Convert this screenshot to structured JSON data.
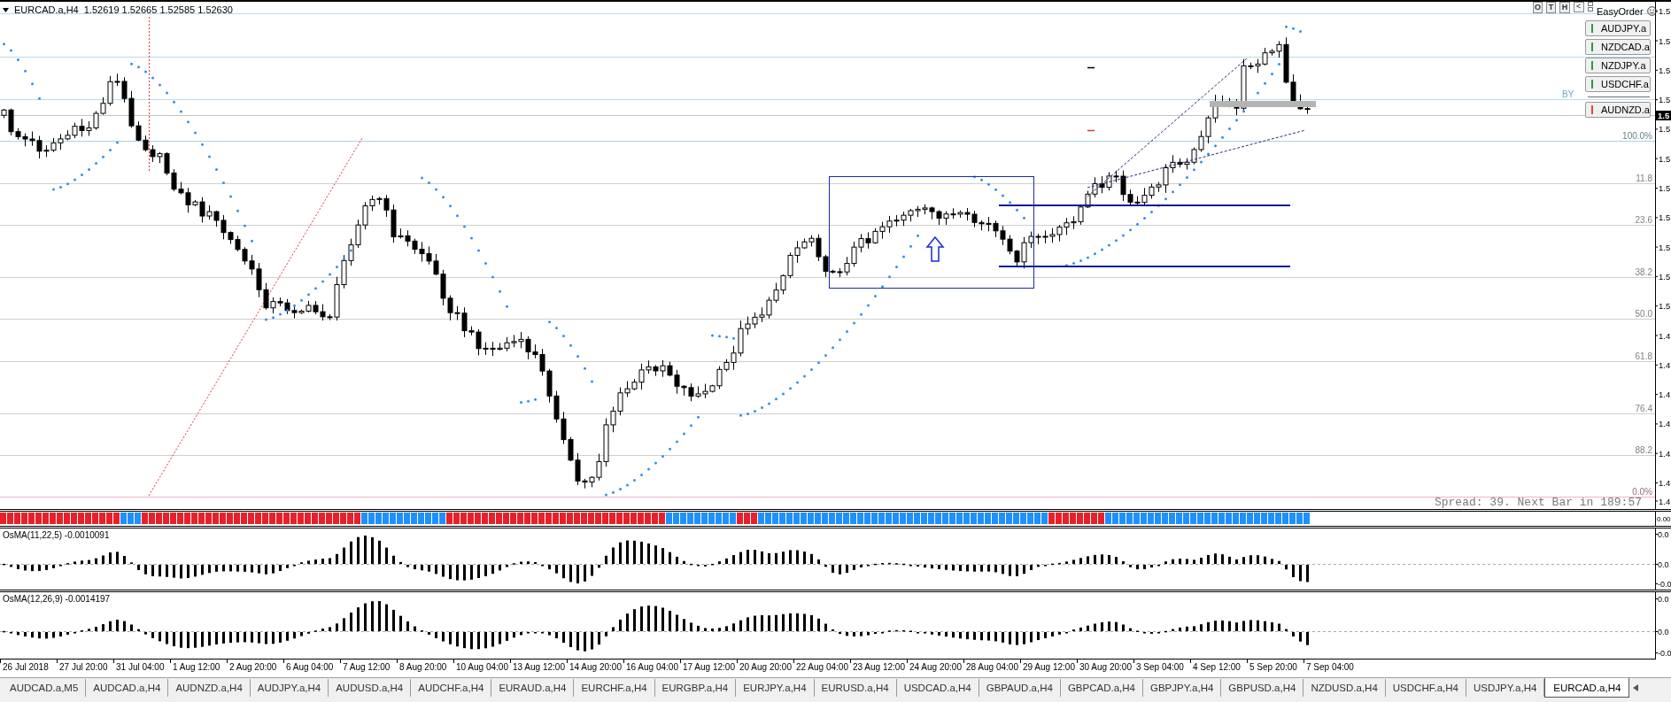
{
  "chart": {
    "symbol": "EURCAD.a,H4",
    "quote": "1.52619 1.52665 1.52585 1.52630",
    "fib_levels": [
      {
        "label": "100.0%",
        "color": "#a9d3e2"
      },
      {
        "label": "11.8",
        "color": "#cfcfcf"
      },
      {
        "label": "23.6",
        "color": "#cfcfcf"
      },
      {
        "label": "38.2",
        "color": "#cfcfcf"
      },
      {
        "label": "50.0",
        "color": "#cfcfcf"
      },
      {
        "label": "61.8",
        "color": "#cfcfcf"
      },
      {
        "label": "76.4",
        "color": "#cfcfcf"
      },
      {
        "label": "88.2",
        "color": "#cfcfcf"
      },
      {
        "label": "0.0%",
        "color": "#f2b3bf"
      }
    ],
    "level_label": "BY",
    "price_axis": [
      "1.5",
      "1.5",
      "1.5",
      "1.5",
      "1.5",
      "1.5",
      "1.5",
      "1.5",
      "1.5",
      "1.5",
      "1.5",
      "1.4",
      "1.4",
      "1.4",
      "1.4",
      "1.4",
      "1.4",
      "1.4"
    ],
    "current_price": "1.5",
    "spread": "Spread: 39. Next Bar in 189:57"
  },
  "easy_order": {
    "buttons": [
      "O",
      "T",
      "H",
      "<"
    ],
    "title": "EasyOrder",
    "symbols": [
      {
        "label": "AUDJPY.a",
        "color": "#2f9a3c"
      },
      {
        "label": "NZDCAD.a",
        "color": "#2f9a3c"
      },
      {
        "label": "NZDJPY.a",
        "color": "#2f9a3c"
      },
      {
        "label": "USDCHF.a",
        "color": "#2f9a3c"
      },
      {
        "label": "AUDNZD.a",
        "color": "#e2453f"
      }
    ]
  },
  "signal_pane": {
    "axis": [
      "0.00"
    ]
  },
  "osma_panes": [
    {
      "label": "OsMA(11,22,5) -0.0010091",
      "axis": [
        "0.0",
        "0.0",
        "-0.0"
      ]
    },
    {
      "label": "OsMA(12,26,9) -0.0014197",
      "axis": [
        "0.0",
        "0.0",
        "-0.0"
      ]
    }
  ],
  "time_axis": [
    "26 Jul 2018",
    "27 Jul 20:00",
    "31 Jul 04:00",
    "1 Aug 12:00",
    "2 Aug 20:00",
    "6 Aug 04:00",
    "7 Aug 12:00",
    "8 Aug 20:00",
    "10 Aug 04:00",
    "13 Aug 12:00",
    "14 Aug 20:00",
    "16 Aug 04:00",
    "17 Aug 12:00",
    "20 Aug 20:00",
    "22 Aug 04:00",
    "23 Aug 12:00",
    "24 Aug 20:00",
    "28 Aug 04:00",
    "29 Aug 12:00",
    "30 Aug 20:00",
    "3 Sep 04:00",
    "4 Sep 12:00",
    "5 Sep 20:00",
    "7 Sep 04:00"
  ],
  "tabs": [
    {
      "label": "AUDCAD.a,M5",
      "selected": false
    },
    {
      "label": "AUDCAD.a,H4",
      "selected": false
    },
    {
      "label": "AUDNZD.a,H4",
      "selected": false
    },
    {
      "label": "AUDJPY.a,H4",
      "selected": false
    },
    {
      "label": "AUDUSD.a,H4",
      "selected": false
    },
    {
      "label": "AUDCHF.a,H4",
      "selected": false
    },
    {
      "label": "EURAUD.a,H4",
      "selected": false
    },
    {
      "label": "EURCHF.a,H4",
      "selected": false
    },
    {
      "label": "EURGBP.a,H4",
      "selected": false
    },
    {
      "label": "EURJPY.a,H4",
      "selected": false
    },
    {
      "label": "EURUSD.a,H4",
      "selected": false
    },
    {
      "label": "USDCAD.a,H4",
      "selected": false
    },
    {
      "label": "GBPAUD.a,H4",
      "selected": false
    },
    {
      "label": "GBPCAD.a,H4",
      "selected": false
    },
    {
      "label": "GBPJPY.a,H4",
      "selected": false
    },
    {
      "label": "GBPUSD.a,H4",
      "selected": false
    },
    {
      "label": "NZDUSD.a,H4",
      "selected": false
    },
    {
      "label": "USDCHF.a,H4",
      "selected": false
    },
    {
      "label": "USDJPY.a,H4",
      "selected": false
    },
    {
      "label": "EURCAD.a,H4",
      "selected": true
    }
  ]
}
